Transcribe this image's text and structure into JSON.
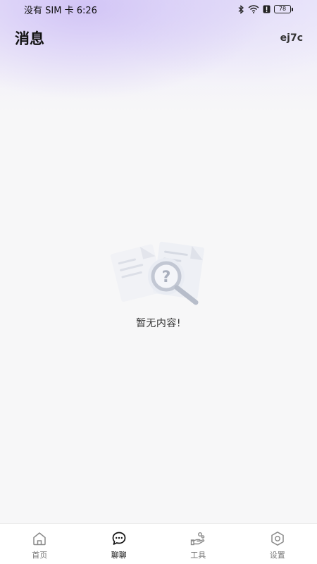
{
  "status_bar": {
    "carrier_time": "没有 SIM 卡 6:26",
    "battery_level": "78",
    "icons": [
      "bluetooth-icon",
      "wifi-icon",
      "alert-icon",
      "battery-icon"
    ]
  },
  "header": {
    "title": "消息",
    "user_code": "ej7c"
  },
  "empty_state": {
    "icon": "document-search-icon",
    "message": "暂无内容!"
  },
  "bottom_nav": {
    "active_index": 1,
    "items": [
      {
        "label": "首页",
        "icon": "home-icon"
      },
      {
        "label": "聊聊",
        "icon": "chat-bubble-icon"
      },
      {
        "label": "工具",
        "icon": "tools-hand-icon"
      },
      {
        "label": "设置",
        "icon": "hexagon-settings-icon"
      }
    ]
  },
  "colors": {
    "accent_gradient": "#cdbef5",
    "background": "#f7f7f8",
    "nav_active": "#111111",
    "nav_inactive": "#777777"
  }
}
